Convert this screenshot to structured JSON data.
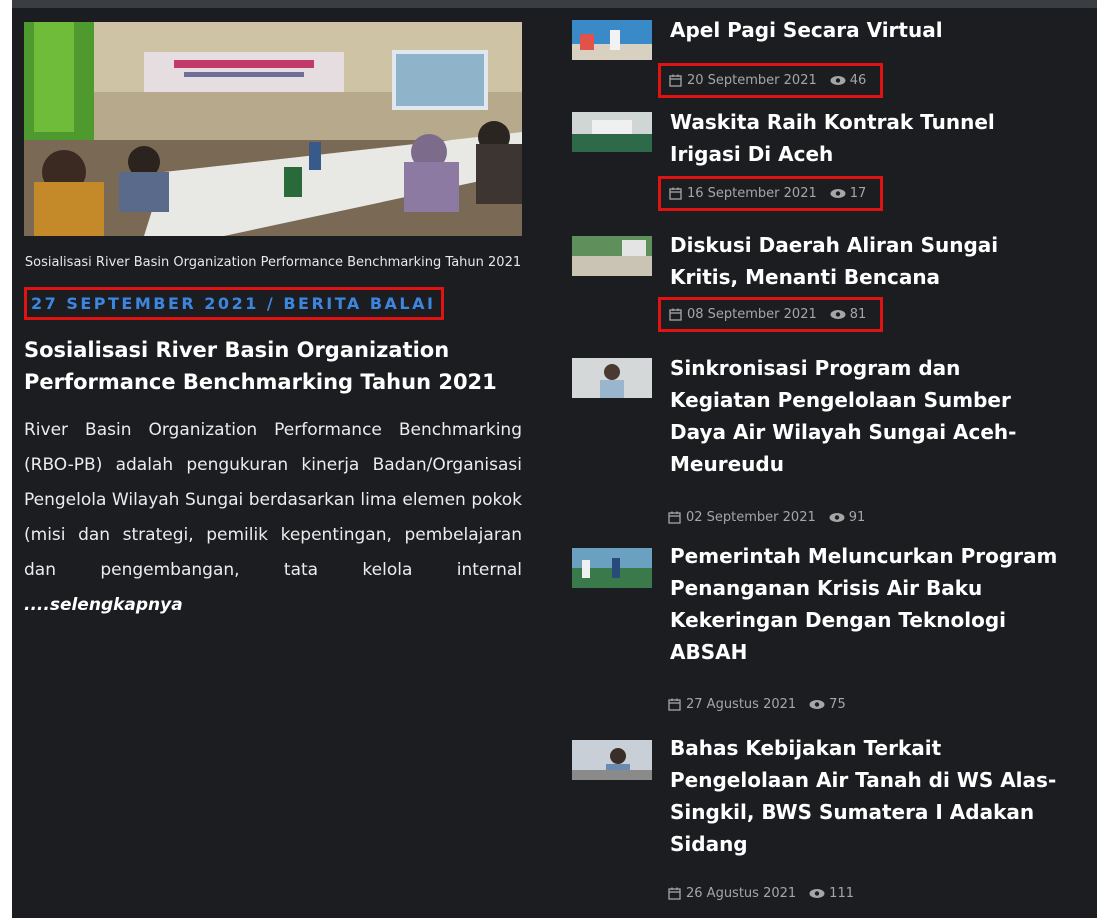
{
  "featured": {
    "caption": "Sosialisasi River Basin Organization Performance Benchmarking Tahun 2021",
    "date": "27 SEPTEMBER 2021",
    "separator": "/",
    "category": "BERITA BALAI",
    "title": "Sosialisasi River Basin Organization Performance Benchmarking Tahun 2021",
    "excerpt": "River Basin Organization Performance Benchmarking (RBO-PB) adalah pengukuran kinerja Badan/Organisasi Pengelola Wilayah Sungai berdasarkan lima elemen pokok (misi dan strategi, pemilik kepentingan, pembelajaran dan pengembangan, tata kelola internal ",
    "more_label": "....selengkapnya"
  },
  "news": [
    {
      "title": "Apel Pagi Secara Virtual",
      "date": "20 September 2021",
      "views": "46"
    },
    {
      "title": "Waskita Raih Kontrak Tunnel Irigasi Di Aceh",
      "date": "16 September 2021",
      "views": "17"
    },
    {
      "title": "Diskusi Daerah Aliran Sungai Kritis, Menanti Bencana",
      "date": "08 September 2021",
      "views": "81"
    },
    {
      "title": "Sinkronisasi Program dan Kegiatan Pengelolaan Sumber Daya Air Wilayah Sungai Aceh-Meureudu",
      "date": "02 September 2021",
      "views": "91"
    },
    {
      "title": "Pemerintah Meluncurkan Program Penanganan Krisis Air Baku Kekeringan Dengan Teknologi ABSAH",
      "date": "27 Agustus 2021",
      "views": "75"
    },
    {
      "title": "Bahas Kebijakan Terkait Pengelolaan Air Tanah di WS Alas-Singkil, BWS Sumatera I Adakan Sidang",
      "date": "26 Agustus 2021",
      "views": "111"
    }
  ],
  "colors": {
    "background": "#1b1d21",
    "accent": "#3d86e0",
    "highlight": "#e01313"
  },
  "icons": {
    "date": "calendar-icon",
    "views": "eye-icon"
  }
}
